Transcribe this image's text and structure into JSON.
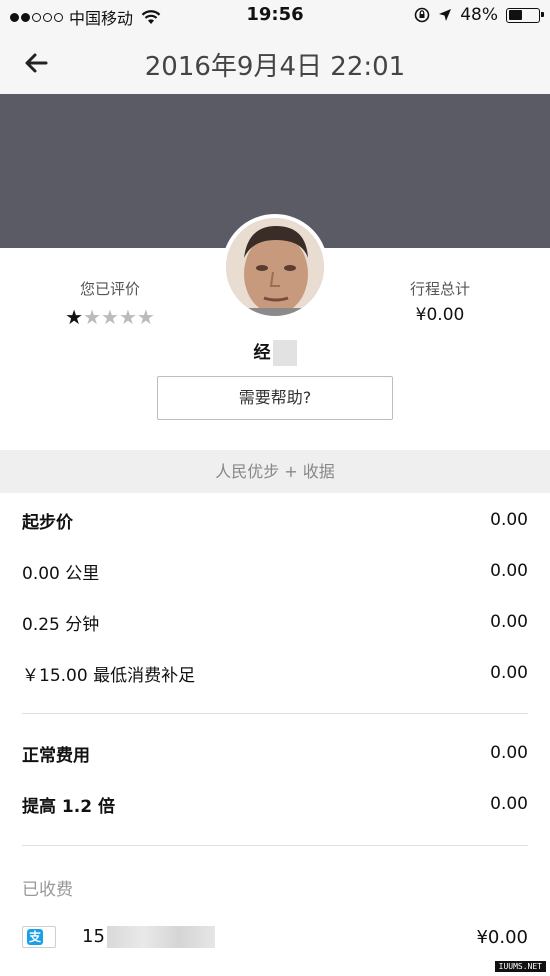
{
  "status_bar": {
    "carrier": "中国移动",
    "time": "19:56",
    "battery": "48%",
    "battery_level": 0.48,
    "icons": [
      "signal-dots-icon",
      "wifi-icon",
      "orientation-lock-icon",
      "location-arrow-icon",
      "battery-icon"
    ]
  },
  "nav": {
    "title": "2016年9月4日  22:01",
    "back_icon": "arrow-left-icon"
  },
  "trip": {
    "rating_label": "您已评价",
    "rating_value": 1,
    "rating_max": 5,
    "total_label": "行程总计",
    "total_value": "¥0.00",
    "driver_name": "经"
  },
  "help_button": "需要帮助?",
  "receipt": {
    "header": "人民优步 + 收据",
    "fare_items": [
      {
        "label": "起步价",
        "value": "0.00"
      },
      {
        "label": "0.00 公里",
        "value": "0.00"
      },
      {
        "label": "0.25 分钟",
        "value": "0.00"
      },
      {
        "label": "￥15.00 最低消费补足",
        "value": "0.00"
      }
    ],
    "adjust_items": [
      {
        "label": "正常费用",
        "value": "0.00"
      },
      {
        "label": "提高 1.2 倍",
        "value": "0.00"
      }
    ],
    "paid_label": "已收费",
    "payment": {
      "icon": "alipay-icon",
      "icon_glyph": "支",
      "account_prefix": "15",
      "amount": "¥0.00"
    }
  },
  "watermark": "IUUMS.NET",
  "colors": {
    "map_band": "#5b5b66",
    "section_bg": "#efeff0",
    "alipay_blue": "#1aa0e8"
  }
}
